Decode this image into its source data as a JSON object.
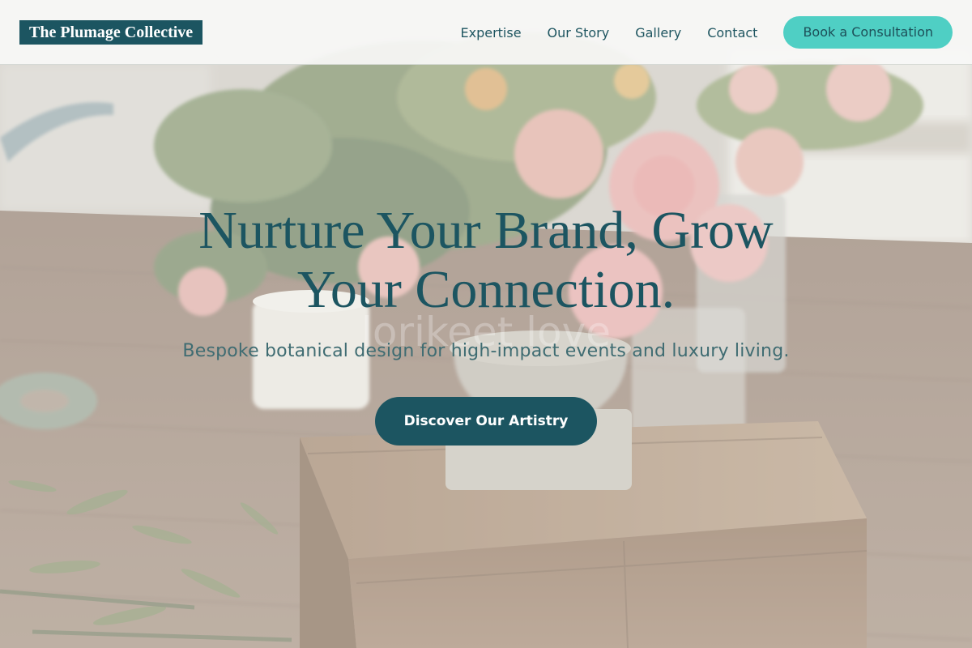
{
  "header": {
    "logo_text": "The Plumage Collective",
    "nav_items": [
      "Expertise",
      "Our Story",
      "Gallery",
      "Contact"
    ],
    "cta_label": "Book a Consultation"
  },
  "hero": {
    "headline_line1": "Nurture Your Brand, Grow",
    "headline_line2": "Your Connection.",
    "watermark_text": "lorikeet love",
    "subheadline": "Bespoke botanical design for high-impact events and luxury living.",
    "cta_label": "Discover Our Artistry"
  },
  "colors": {
    "brand_dark_teal": "#1c5561",
    "accent_teal": "#4fcfc4",
    "subheadline_text": "#3f6c72"
  }
}
